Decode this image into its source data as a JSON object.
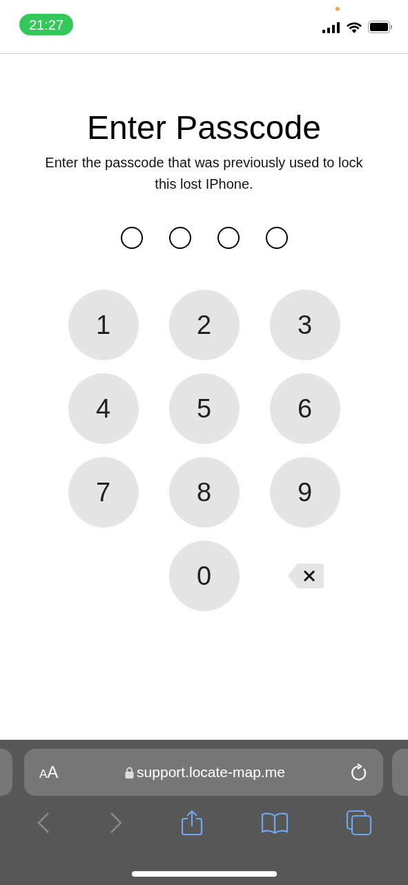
{
  "status_bar": {
    "time": "21:27",
    "recording_dot": true
  },
  "title": "Enter Passcode",
  "subtitle": "Enter the passcode that was previously used to lock this lost IPhone.",
  "passcode_dots": [
    {
      "filled": false
    },
    {
      "filled": false
    },
    {
      "filled": false
    },
    {
      "filled": false
    }
  ],
  "keypad": [
    {
      "kind": "digit",
      "label": "1"
    },
    {
      "kind": "digit",
      "label": "2"
    },
    {
      "kind": "digit",
      "label": "3"
    },
    {
      "kind": "digit",
      "label": "4"
    },
    {
      "kind": "digit",
      "label": "5"
    },
    {
      "kind": "digit",
      "label": "6"
    },
    {
      "kind": "digit",
      "label": "7"
    },
    {
      "kind": "digit",
      "label": "8"
    },
    {
      "kind": "digit",
      "label": "9"
    },
    {
      "kind": "blank"
    },
    {
      "kind": "digit",
      "label": "0"
    },
    {
      "kind": "delete"
    }
  ],
  "browser": {
    "text_size_button": "AA",
    "url": "support.locate-map.me",
    "back_disabled": true,
    "forward_disabled": true
  }
}
